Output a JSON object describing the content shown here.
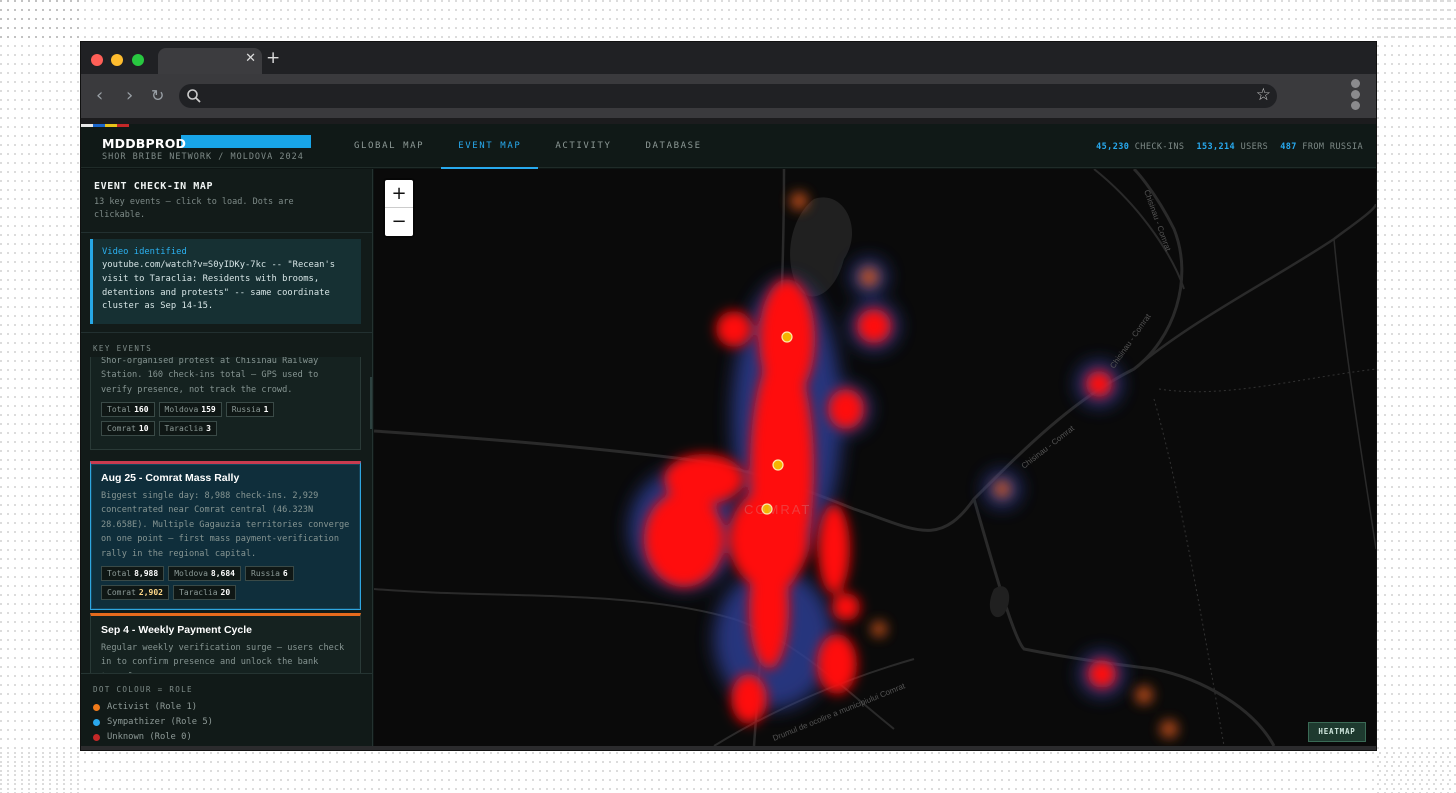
{
  "browser": {
    "tab_close": "✕",
    "new_tab": "+",
    "url": ""
  },
  "app": {
    "brand": "MDDBPROD",
    "brand_subtitle": "SHOR BRIBE NETWORK / MOLDOVA 2024",
    "flag_colors": [
      "#e8e8e8",
      "#1a66cc",
      "#e8c31a",
      "#c42828"
    ],
    "nav": [
      {
        "label": "GLOBAL MAP",
        "active": false
      },
      {
        "label": "EVENT MAP",
        "active": true
      },
      {
        "label": "ACTIVITY",
        "active": false
      },
      {
        "label": "DATABASE",
        "active": false
      }
    ],
    "stats": [
      {
        "value": "45,230",
        "label": "CHECK-INS"
      },
      {
        "value": "153,214",
        "label": "USERS"
      },
      {
        "value": "487",
        "label": "FROM RUSSIA"
      }
    ]
  },
  "sidebar": {
    "title": "EVENT CHECK-IN MAP",
    "subtitle": "13 key events — click to load. Dots are clickable.",
    "callout": {
      "title": "Video identified",
      "body": "youtube.com/watch?v=S0yIDKy-7kc -- \"Recean's visit to Taraclia: Residents with brooms, detentions and protests\" -- same coordinate cluster as Sep 14-15."
    },
    "key_events_label": "KEY EVENTS",
    "events": [
      {
        "title": "",
        "desc": "Shor-organised protest at Chisinau Railway Station. 160 check-ins total — GPS used to verify presence, not track the crowd.",
        "chips": [
          {
            "label": "Total",
            "value": "160"
          },
          {
            "label": "Moldova",
            "value": "159"
          },
          {
            "label": "Russia",
            "value": "1"
          },
          {
            "label": "Comrat",
            "value": "10"
          },
          {
            "label": "Taraclia",
            "value": "3"
          }
        ]
      },
      {
        "title": "Aug 25 - Comrat Mass Rally",
        "desc": "Biggest single day: 8,988 check-ins. 2,929 concentrated near Comrat central (46.323N 28.658E). Multiple Gagauzia territories converge on one point — first mass payment-verification rally in the regional capital.",
        "chips": [
          {
            "label": "Total",
            "value": "8,988"
          },
          {
            "label": "Moldova",
            "value": "8,684"
          },
          {
            "label": "Russia",
            "value": "6"
          },
          {
            "label": "Comrat",
            "value": "2,902"
          },
          {
            "label": "Taraclia",
            "value": "20"
          }
        ]
      },
      {
        "title": "Sep 4 - Weekly Payment Cycle",
        "desc": "Regular weekly verification surge — users check in to confirm presence and unlock the bank transfer.",
        "chips": []
      }
    ],
    "legend": {
      "title": "DOT COLOUR = ROLE",
      "items": [
        {
          "label": "Activist (Role 1)",
          "color": "#f07a1a"
        },
        {
          "label": "Sympathizer (Role 5)",
          "color": "#2aa8ee"
        },
        {
          "label": "Unknown (Role 0)",
          "color": "#c42828"
        }
      ]
    }
  },
  "map": {
    "zoom_in": "+",
    "zoom_out": "−",
    "heatmap_label": "HEATMAP",
    "labels": {
      "city": "COMRAT",
      "road_ne": "Chisinau - Comrat",
      "road_e": "Chisinau - Comrat",
      "road_top": "Chisinau - Comrat",
      "road_s": "Drumul de ocolire a municipiului Comrat"
    }
  }
}
